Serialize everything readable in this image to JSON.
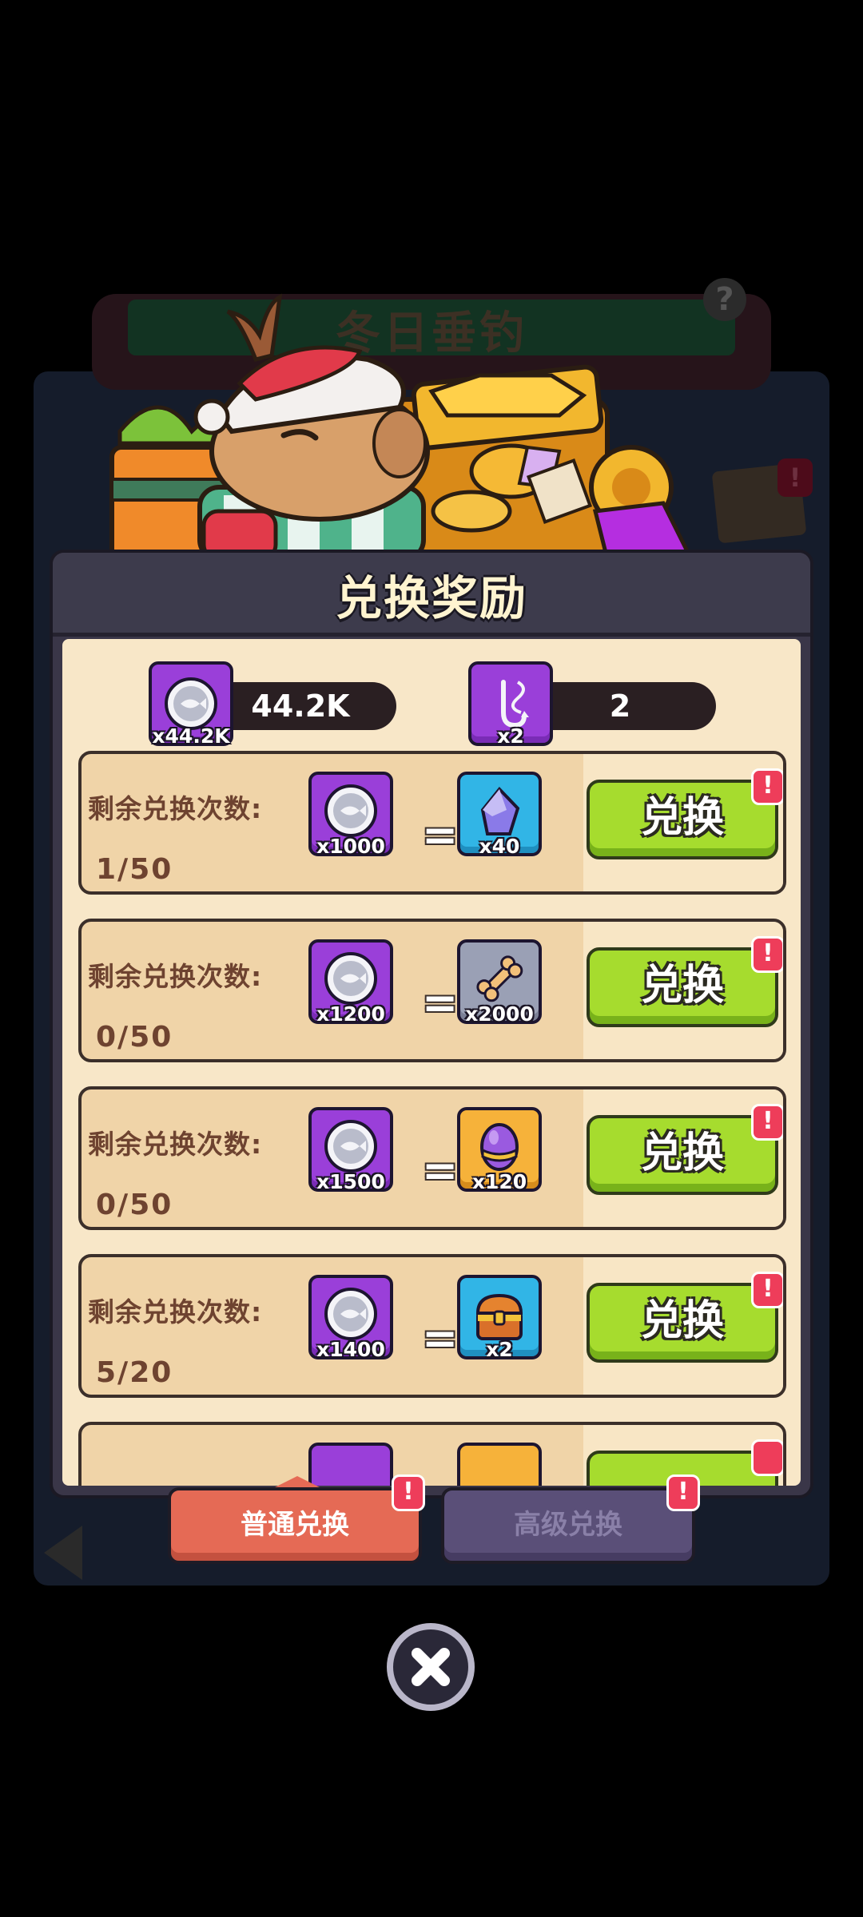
{
  "background": {
    "banner_title": "冬日垂钓",
    "help_symbol": "?",
    "alert_symbol": "!"
  },
  "dialog": {
    "title": "兑换奖励"
  },
  "currencies": [
    {
      "icon": "fish-coin-icon",
      "tile_qty": "x44.2K",
      "amount": "44.2K"
    },
    {
      "icon": "fishing-hook-icon",
      "tile_qty": "x2",
      "amount": "2"
    }
  ],
  "rows": [
    {
      "label": "剩余兑换次数:",
      "count": "1/50",
      "cost_icon": "fish-coin-icon",
      "cost_qty": "x1000",
      "reward_icon": "crystal-icon",
      "reward_qty": "x40",
      "reward_color": "#31b5e6",
      "button": "兑换",
      "alert": "!"
    },
    {
      "label": "剩余兑换次数:",
      "count": "0/50",
      "cost_icon": "fish-coin-icon",
      "cost_qty": "x1200",
      "reward_icon": "bone-icon",
      "reward_qty": "x2000",
      "reward_color": "#9aa0b5",
      "button": "兑换",
      "alert": "!"
    },
    {
      "label": "剩余兑换次数:",
      "count": "0/50",
      "cost_icon": "fish-coin-icon",
      "cost_qty": "x1500",
      "reward_icon": "egg-icon",
      "reward_qty": "x120",
      "reward_color": "#f6b23a",
      "button": "兑换",
      "alert": "!"
    },
    {
      "label": "剩余兑换次数:",
      "count": "5/20",
      "cost_icon": "fish-coin-icon",
      "cost_qty": "x1400",
      "reward_icon": "treasure-chest-icon",
      "reward_qty": "x2",
      "reward_color": "#31b5e6",
      "button": "兑换",
      "alert": "!"
    }
  ],
  "tabs": [
    {
      "label": "普通兑换",
      "active": true,
      "alert": "!"
    },
    {
      "label": "高级兑换",
      "active": false,
      "alert": "!"
    }
  ],
  "close_icon": "close-icon"
}
